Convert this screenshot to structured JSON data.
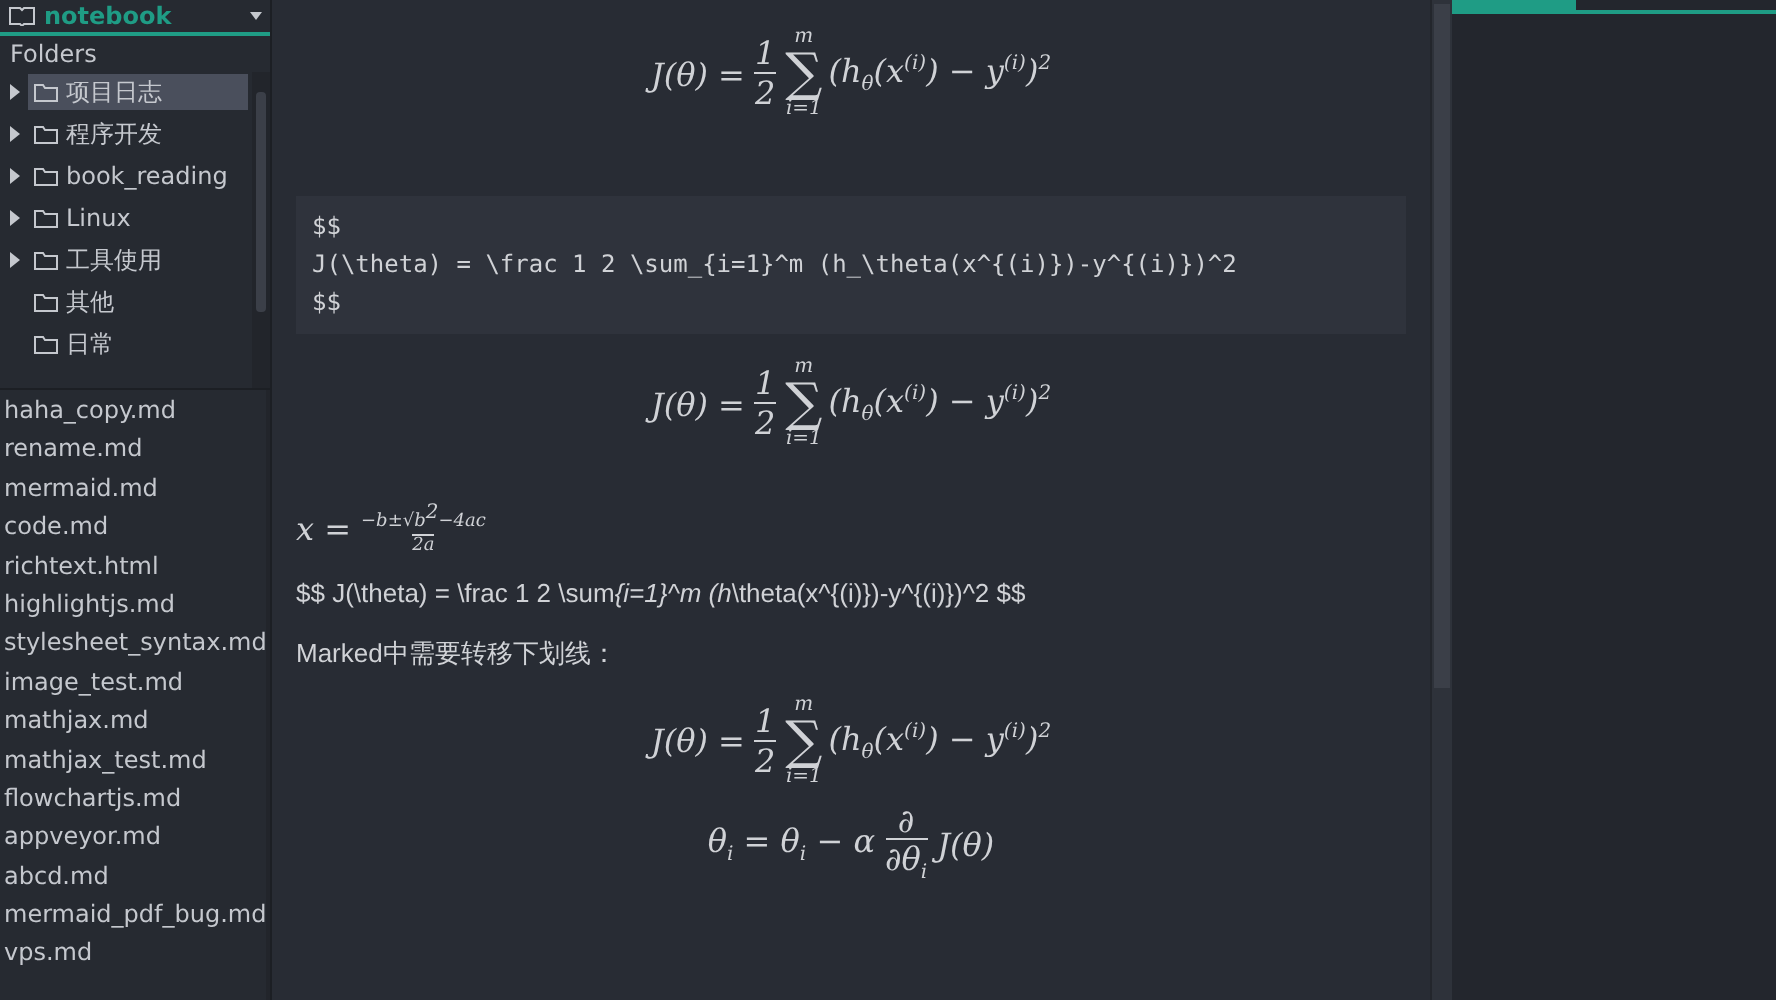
{
  "notebook": {
    "name": "notebook"
  },
  "folders": {
    "label": "Folders",
    "items": [
      {
        "name": "项目日志",
        "expandable": true,
        "selected": true
      },
      {
        "name": "程序开发",
        "expandable": true,
        "selected": false
      },
      {
        "name": "book_reading",
        "expandable": true,
        "selected": false
      },
      {
        "name": "Linux",
        "expandable": true,
        "selected": false
      },
      {
        "name": "工具使用",
        "expandable": true,
        "selected": false
      },
      {
        "name": "其他",
        "expandable": false,
        "selected": false
      },
      {
        "name": "日常",
        "expandable": false,
        "selected": false
      }
    ]
  },
  "files": [
    "haha_copy.md",
    "rename.md",
    "mermaid.md",
    "code.md",
    "richtext.html",
    "highlightjs.md",
    "stylesheet_syntax.md",
    "image_test.md",
    "mathjax.md",
    "mathjax_test.md",
    "flowchartjs.md",
    "appveyor.md",
    "abcd.md",
    "mermaid_pdf_bug.md",
    "vps.md"
  ],
  "content": [
    {
      "kind": "math",
      "parts": [
        {
          "kind": "text",
          "text": "J(θ) ="
        },
        {
          "kind": "frac",
          "num": "1",
          "den": "2"
        },
        {
          "kind": "sum",
          "symbol": "∑",
          "over": "m",
          "under": "i=1"
        },
        {
          "kind": "text",
          "text": "(h$_{θ}$(x$^{(i)}$) − y$^{(i)}$)$^{2}$"
        }
      ]
    },
    {
      "kind": "code",
      "lines": [
        "$$",
        "J(\\theta) = \\frac 1 2 \\sum_{i=1}^m (h_\\theta(x^{(i)})-y^{(i)})^2",
        "$$"
      ]
    },
    {
      "kind": "math",
      "parts": [
        {
          "kind": "text",
          "text": "J(θ) ="
        },
        {
          "kind": "frac",
          "num": "1",
          "den": "2"
        },
        {
          "kind": "sum",
          "symbol": "∑",
          "over": "m",
          "under": "i=1"
        },
        {
          "kind": "text",
          "text": "(h$_{θ}$(x$^{(i)}$) − y$^{(i)}$)$^{2}$"
        }
      ]
    },
    {
      "kind": "inline-math",
      "parts": [
        {
          "kind": "text",
          "text": "x ="
        },
        {
          "kind": "smallfrac",
          "num": "−b±√b$^{2}$−4ac",
          "den": "2a"
        }
      ]
    },
    {
      "kind": "segments",
      "parts": [
        {
          "text": "$$ J(\\theta) = \\frac 1 2 \\sum",
          "italic": false
        },
        {
          "text": "{i=1}^m (h",
          "italic": true
        },
        {
          "text": "\\theta(x^{(i)})-y^{(i)})^2 $$",
          "italic": false
        }
      ]
    },
    {
      "kind": "paragraph",
      "text": "Marked中需要转移下划线："
    },
    {
      "kind": "math",
      "parts": [
        {
          "kind": "text",
          "text": "J(θ) ="
        },
        {
          "kind": "frac",
          "num": "1",
          "den": "2"
        },
        {
          "kind": "sum",
          "symbol": "∑",
          "over": "m",
          "under": "i=1"
        },
        {
          "kind": "text",
          "text": "(h$_{θ}$(x$^{(i)}$) − y$^{(i)}$)$^{2}$"
        }
      ]
    },
    {
      "kind": "math",
      "parts": [
        {
          "kind": "text",
          "text": "θ$_{i}$ = θ$_{i}$ − α"
        },
        {
          "kind": "frac",
          "num": "∂",
          "den": "∂θ$_{i}$"
        },
        {
          "kind": "text",
          "text": "J(θ)"
        }
      ]
    }
  ]
}
